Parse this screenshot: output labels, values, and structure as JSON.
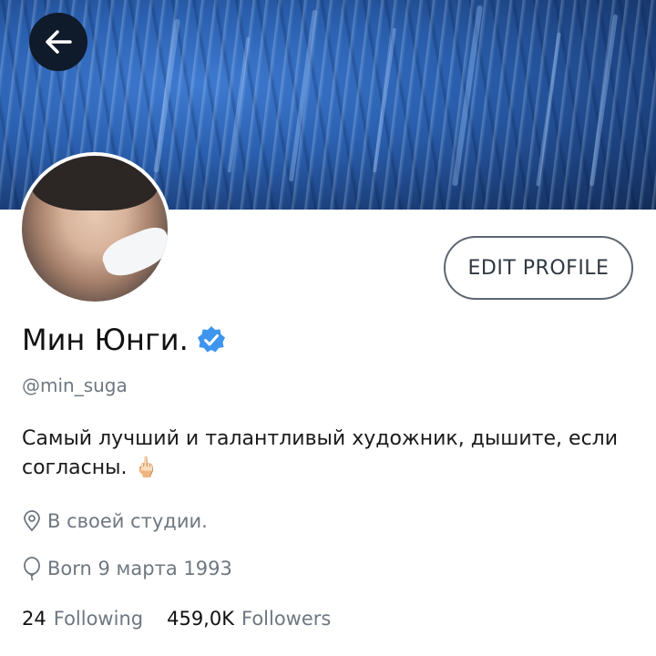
{
  "header": {
    "back_icon": "arrow-left-icon"
  },
  "profile": {
    "name": "Мин Юнги.",
    "verified_icon": "verified-badge-icon",
    "handle": "@min_suga",
    "edit_button_label": "EDIT PROFILE",
    "bio_text": "Самый лучший и талантливый художник, дышите, если согласны.",
    "bio_emoji": "🖕🏻",
    "location": "В своей студии.",
    "location_icon": "location-pin-icon",
    "born": "Born 9 марта 1993",
    "born_icon": "balloon-icon"
  },
  "stats": {
    "following_count": "24",
    "following_label": "Following",
    "followers_count": "459,0K",
    "followers_label": "Followers"
  },
  "colors": {
    "verified": "#3d95ee",
    "secondary_text": "#6e7780",
    "banner_blue": "#2a5fae"
  }
}
